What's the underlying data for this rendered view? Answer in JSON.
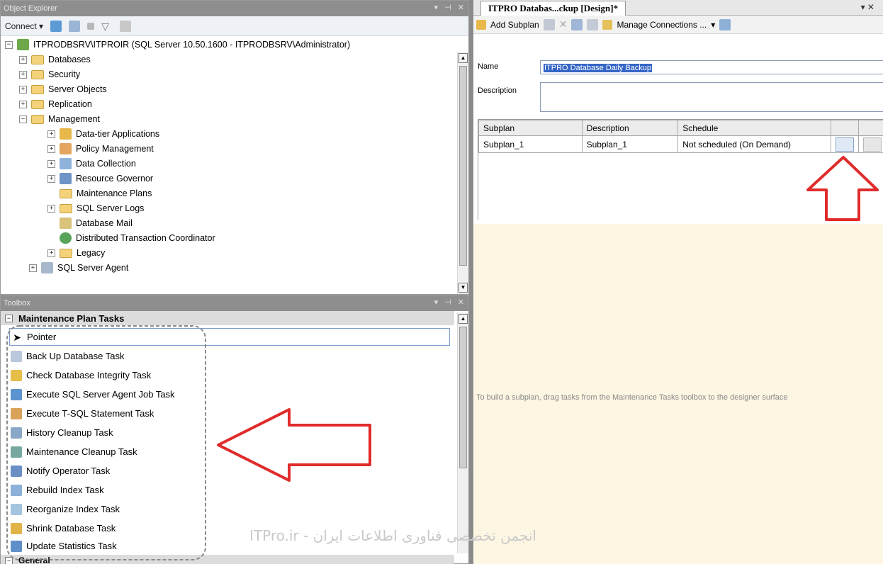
{
  "object_explorer": {
    "title": "Object Explorer",
    "connect_label": "Connect ▾",
    "tree": [
      {
        "label": "ITPRODBSRV\\ITPROIR (SQL Server 10.50.1600 - ITPRODBSRV\\Administrator)",
        "icon": "server-icon",
        "state": "−"
      },
      {
        "label": "Databases",
        "icon": "folder-icon",
        "state": "+"
      },
      {
        "label": "Security",
        "icon": "folder-icon",
        "state": "+"
      },
      {
        "label": "Server Objects",
        "icon": "folder-icon",
        "state": "+"
      },
      {
        "label": "Replication",
        "icon": "folder-icon",
        "state": "+"
      },
      {
        "label": "Management",
        "icon": "folder-icon",
        "state": "−"
      },
      {
        "label": "Data-tier Applications",
        "icon": "data-tier-icon",
        "state": "+"
      },
      {
        "label": "Policy Management",
        "icon": "policy-icon",
        "state": "+"
      },
      {
        "label": "Data Collection",
        "icon": "data-collection-icon",
        "state": "+"
      },
      {
        "label": "Resource Governor",
        "icon": "resource-governor-icon",
        "state": "+"
      },
      {
        "label": "Maintenance Plans",
        "icon": "folder-icon",
        "state": ""
      },
      {
        "label": "SQL Server Logs",
        "icon": "folder-icon",
        "state": "+"
      },
      {
        "label": "Database Mail",
        "icon": "mail-icon",
        "state": ""
      },
      {
        "label": "Distributed Transaction Coordinator",
        "icon": "dtc-icon",
        "state": ""
      },
      {
        "label": "Legacy",
        "icon": "folder-icon",
        "state": "+"
      },
      {
        "label": "SQL Server Agent",
        "icon": "agent-icon",
        "state": "+"
      }
    ]
  },
  "toolbox": {
    "title": "Toolbox",
    "category": "Maintenance Plan Tasks",
    "items": [
      {
        "label": "Pointer",
        "icon": "pointer-icon"
      },
      {
        "label": "Back Up Database Task",
        "icon": "backup-icon"
      },
      {
        "label": "Check Database Integrity Task",
        "icon": "integrity-icon"
      },
      {
        "label": "Execute SQL Server Agent Job Task",
        "icon": "agent-job-icon"
      },
      {
        "label": "Execute T-SQL Statement Task",
        "icon": "tsql-icon"
      },
      {
        "label": "History Cleanup Task",
        "icon": "history-icon"
      },
      {
        "label": "Maintenance Cleanup Task",
        "icon": "cleanup-icon"
      },
      {
        "label": "Notify Operator Task",
        "icon": "operator-icon"
      },
      {
        "label": "Rebuild Index Task",
        "icon": "rebuild-icon"
      },
      {
        "label": "Reorganize Index Task",
        "icon": "reorganize-icon"
      },
      {
        "label": "Shrink Database Task",
        "icon": "shrink-icon"
      },
      {
        "label": "Update Statistics Task",
        "icon": "statistics-icon"
      }
    ],
    "general_label": "General"
  },
  "designer": {
    "tab_title": "ITPRO Databas...ckup [Design]*",
    "toolbar": {
      "add_subplan": "Add Subplan",
      "manage_connections": "Manage Connections ..."
    },
    "name_label": "Name",
    "name_value": "ITPRO Database Daily Backup",
    "description_label": "Description",
    "grid": {
      "headers": [
        "Subplan",
        "Description",
        "Schedule"
      ],
      "rows": [
        {
          "subplan": "Subplan_1",
          "description": "Subplan_1",
          "schedule": "Not scheduled (On Demand)"
        }
      ]
    },
    "design_message": "To build a subplan, drag tasks from the Maintenance Tasks toolbox to the designer surface"
  },
  "watermark": "ITPro.ir - انجمن تخصصی فناوری اطلاعات ایران",
  "colors": {
    "annotation_red": "#e02b2b",
    "selection_blue": "#3566c6",
    "design_surface": "#fdf6e3",
    "folder_yellow": "#f3d27a"
  }
}
